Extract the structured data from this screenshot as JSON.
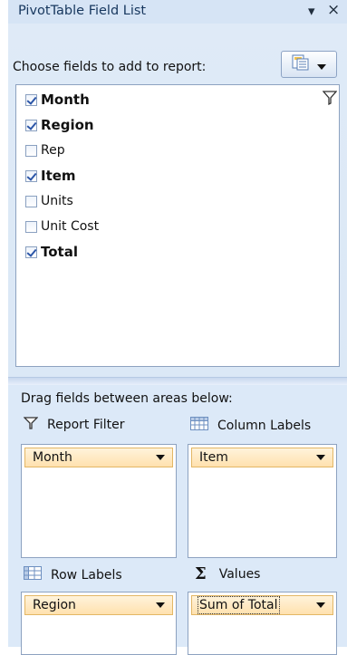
{
  "title_bar": {
    "title": "PivotTable Field List",
    "dropdown_glyph": "▾",
    "close_glyph": "×"
  },
  "chooser": {
    "label": "Choose fields to add to report:",
    "layout_button_icon": "field-layout-icon"
  },
  "fields": [
    {
      "label": "Month",
      "checked": true,
      "bold": true
    },
    {
      "label": "Region",
      "checked": true,
      "bold": true
    },
    {
      "label": "Rep",
      "checked": false,
      "bold": false
    },
    {
      "label": "Item",
      "checked": true,
      "bold": true
    },
    {
      "label": "Units",
      "checked": false,
      "bold": false
    },
    {
      "label": "Unit Cost",
      "checked": false,
      "bold": false
    },
    {
      "label": "Total",
      "checked": true,
      "bold": true
    }
  ],
  "areas": {
    "drag_label": "Drag fields between areas below:",
    "report_filter": {
      "label": "Report Filter",
      "icon": "filter-icon",
      "chip": "Month"
    },
    "column_labels": {
      "label": "Column Labels",
      "icon": "column-grid-icon",
      "chip": "Item"
    },
    "row_labels": {
      "label": "Row Labels",
      "icon": "row-grid-icon",
      "chip": "Region"
    },
    "values": {
      "label": "Values",
      "icon": "sigma-icon",
      "icon_glyph": "Σ",
      "chip": "Sum of Total"
    }
  },
  "colors": {
    "pane": "#dce9f8",
    "title_text": "#17375e",
    "chip_fill": "#ffe1ae",
    "chip_border": "#e3b765",
    "checkmark": "#2c56a8"
  }
}
